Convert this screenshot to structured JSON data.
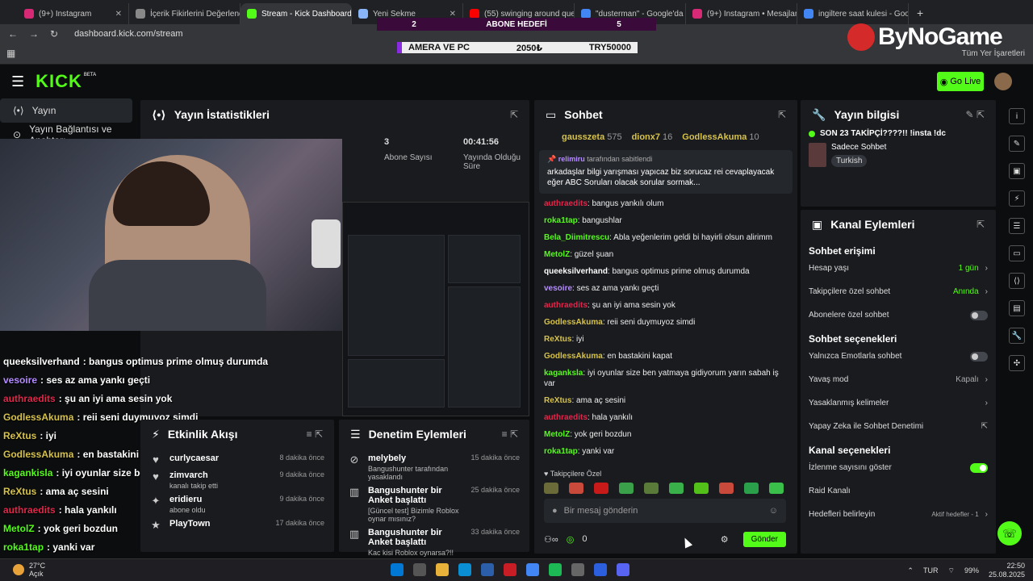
{
  "browser": {
    "tabs": [
      {
        "label": "(9+) Instagram",
        "color": "#d62976"
      },
      {
        "label": "İçerik Fikirlerini Değerlendi",
        "color": "#888888"
      },
      {
        "label": "Stream - Kick Dashboard",
        "color": "#53fc18",
        "active": true
      },
      {
        "label": "Yeni Sekme",
        "color": "#8ab4f8"
      },
      {
        "label": "(55) swinging around que",
        "color": "#ff0000"
      },
      {
        "label": "\"dusterman\" - Google'da",
        "color": "#4285f4"
      },
      {
        "label": "(9+) Instagram • Mesajlar",
        "color": "#d62976"
      },
      {
        "label": "ingiltere saat kulesi - Goo",
        "color": "#4285f4"
      }
    ],
    "url": "dashboard.kick.com/stream",
    "all_bookmarks": "Tüm Yer İşaretleri"
  },
  "overlay": {
    "left_num": "2",
    "goal_label": "ABONE HEDEFİ",
    "right_num": "5",
    "ticker_left": "AMERA VE PC",
    "ticker_mid": "2050₺",
    "ticker_right": "TRY50000",
    "brand": "ByNoGame"
  },
  "kick": {
    "logo": "KICK",
    "beta": "BETA",
    "go_live": "Go Live",
    "nav": [
      {
        "label": "Yayın",
        "active": true
      },
      {
        "label": "Yayın Bağlantısı ve Anahtarı",
        "active": false
      }
    ]
  },
  "stats": {
    "title": "Yayın İstatistikleri",
    "subs_value": "3",
    "subs_label": "Abone Sayısı",
    "time_value": "00:41:56",
    "time_label": "Yayında Olduğu Süre"
  },
  "overlay_chat": [
    {
      "user": "queeksilverhand",
      "color": "#ffffff",
      "text": "bangus optimus prime olmuş durumda"
    },
    {
      "user": "vesoire",
      "color": "#b58cff",
      "text": "ses az ama yankı geçti"
    },
    {
      "user": "authraedits",
      "color": "#e2264a",
      "text": "şu an iyi ama sesin yok"
    },
    {
      "user": "GodlessAkuma",
      "color": "#d7c24a",
      "text": "reii seni duymuyoz simdi"
    },
    {
      "user": "ReXtus",
      "color": "#d7c24a",
      "text": "iyi"
    },
    {
      "user": "GodlessAkuma",
      "color": "#d7c24a",
      "text": "en bastakini kapat"
    },
    {
      "user": "kagankisla",
      "color": "#53fc18",
      "text": "iyi oyunlar size ben yatmaya gidiyorum yarın sabah iş var"
    },
    {
      "user": "ReXtus",
      "color": "#d7c24a",
      "text": "ama aç sesini"
    },
    {
      "user": "authraedits",
      "color": "#e2264a",
      "text": "hala yankılı"
    },
    {
      "user": "MetolZ",
      "color": "#53fc18",
      "text": "yok geri bozdun"
    },
    {
      "user": "roka1tap",
      "color": "#53fc18",
      "text": "yanki var"
    }
  ],
  "activity": {
    "title": "Etkinlik Akışı",
    "items": [
      {
        "icon": "♥",
        "name": "curlycaesar",
        "sub": "",
        "time": "8 dakika önce"
      },
      {
        "icon": "♥",
        "name": "zimvarch",
        "sub": "kanalı takip etti",
        "time": "9 dakika önce"
      },
      {
        "icon": "✦",
        "name": "eridieru",
        "sub": "abone oldu",
        "time": "9 dakika önce"
      },
      {
        "icon": "★",
        "name": "PlayTown",
        "sub": "",
        "time": "17 dakika önce"
      }
    ]
  },
  "moderation": {
    "title": "Denetim Eylemleri",
    "items": [
      {
        "icon": "⊘",
        "name": "melybely",
        "sub": "Bangushunter tarafından yasaklandı",
        "time": "15 dakika önce"
      },
      {
        "icon": "▥",
        "name": "Bangushunter bir Anket başlattı",
        "sub": "[Güncel test] Bizimle Roblox oynar mısınız?",
        "time": "25 dakika önce"
      },
      {
        "icon": "▥",
        "name": "Bangushunter bir Anket başlattı",
        "sub": "Kac kisi Roblox oynarsa?!!",
        "time": "33 dakika önce"
      }
    ]
  },
  "chat": {
    "title": "Sohbet",
    "leaders": [
      {
        "name": "gausszeta",
        "num": "575"
      },
      {
        "name": "dionx7",
        "num": "16"
      },
      {
        "name": "GodlessAkuma",
        "num": "10"
      }
    ],
    "pinned_by": "relimiru",
    "pinned_suffix": "tarafından sabitlendi",
    "pinned_text": "arkadaşlar bilgi yarışması yapıcaz biz sorucaz rei cevaplayacak eğer ABC Soruları olacak sorular sormak...",
    "messages": [
      {
        "user": "authraedits",
        "color": "#e2264a",
        "text": "bangus yankılı olum"
      },
      {
        "user": "roka1tap",
        "color": "#53fc18",
        "text": "bangushlar"
      },
      {
        "user": "Bela_Diimitrescu",
        "color": "#53fc18",
        "text": "Abla yeğenlerim geldi bi hayirli olsun alirimm"
      },
      {
        "user": "MetolZ",
        "color": "#53fc18",
        "text": "güzel şuan"
      },
      {
        "user": "queeksilverhand",
        "color": "#ffffff",
        "text": "bangus optimus prime olmuş durumda"
      },
      {
        "user": "vesoire",
        "color": "#b58cff",
        "text": "ses az ama yankı geçti"
      },
      {
        "user": "authraedits",
        "color": "#e2264a",
        "text": "şu an iyi ama sesin yok"
      },
      {
        "user": "GodlessAkuma",
        "color": "#d7c24a",
        "text": "reii seni duymuyoz simdi"
      },
      {
        "user": "ReXtus",
        "color": "#d7c24a",
        "text": "iyi"
      },
      {
        "user": "GodlessAkuma",
        "color": "#d7c24a",
        "text": "en bastakini kapat"
      },
      {
        "user": "kaganksla",
        "color": "#53fc18",
        "text": "iyi oyunlar size ben yatmaya gidiyorum yarın sabah iş var"
      },
      {
        "user": "ReXtus",
        "color": "#d7c24a",
        "text": "ama aç sesini"
      },
      {
        "user": "authraedits",
        "color": "#e2264a",
        "text": "hala yankılı"
      },
      {
        "user": "MetolZ",
        "color": "#53fc18",
        "text": "yok geri bozdun"
      },
      {
        "user": "roka1tap",
        "color": "#53fc18",
        "text": "yanki var"
      }
    ],
    "followers_only": "Takipçilere Özel",
    "input_placeholder": "Bir mesaj gönderin",
    "points": "0",
    "send": "Gönder"
  },
  "stream_info": {
    "title": "Yayın bilgisi",
    "stream_title": "SON 23 TAKİPÇİ????!! !insta !dc",
    "category": "Sadece Sohbet",
    "tag": "Turkish"
  },
  "channel_actions": {
    "title": "Kanal Eylemleri",
    "chat_access": "Sohbet erişimi",
    "account_age_label": "Hesap yaşı",
    "account_age_value": "1 gün",
    "followers_only_label": "Takipçilere özel sohbet",
    "followers_only_value": "Anında",
    "subs_only_label": "Abonelere özel sohbet",
    "chat_options": "Sohbet seçenekleri",
    "emote_only_label": "Yalnızca Emotlarla sohbet",
    "slow_mode_label": "Yavaş mod",
    "slow_mode_value": "Kapalı",
    "banned_words_label": "Yasaklanmış kelimeler",
    "ai_mod_label": "Yapay Zeka ile Sohbet Denetimi",
    "channel_options": "Kanal seçenekleri",
    "viewer_count_label": "İzlenme sayısını göster",
    "raid_label": "Raid Kanalı",
    "goals_label": "Hedefleri belirleyin",
    "goals_value": "Aktif hedefler - 1"
  },
  "taskbar": {
    "temp": "27°C",
    "weather": "Açık",
    "lang": "TUR",
    "battery": "99%",
    "time": "22:50",
    "date": "25.08.2025"
  }
}
